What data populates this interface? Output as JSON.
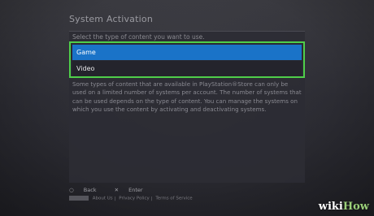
{
  "window": {
    "title": "System Activation"
  },
  "selection": {
    "prompt": "Select the type of content you want to use.",
    "options": [
      {
        "label": "Game",
        "selected": true
      },
      {
        "label": "Video",
        "selected": false
      }
    ]
  },
  "description": "Some types of content that are available in PlayStation®Store can only be used on a limited number of systems per account. The number of systems that can be used depends on the type of content. You can manage the systems on which you use the content by activating and deactivating systems.",
  "footer": {
    "back_label": "Back",
    "enter_label": "Enter",
    "links": [
      "About Us",
      "Privacy Policy",
      "Terms of Service"
    ]
  },
  "watermark": {
    "wiki": "wiki",
    "how": "How"
  },
  "colors": {
    "selected_bg": "#1a73c8",
    "focus_border": "#4fcf4a"
  }
}
